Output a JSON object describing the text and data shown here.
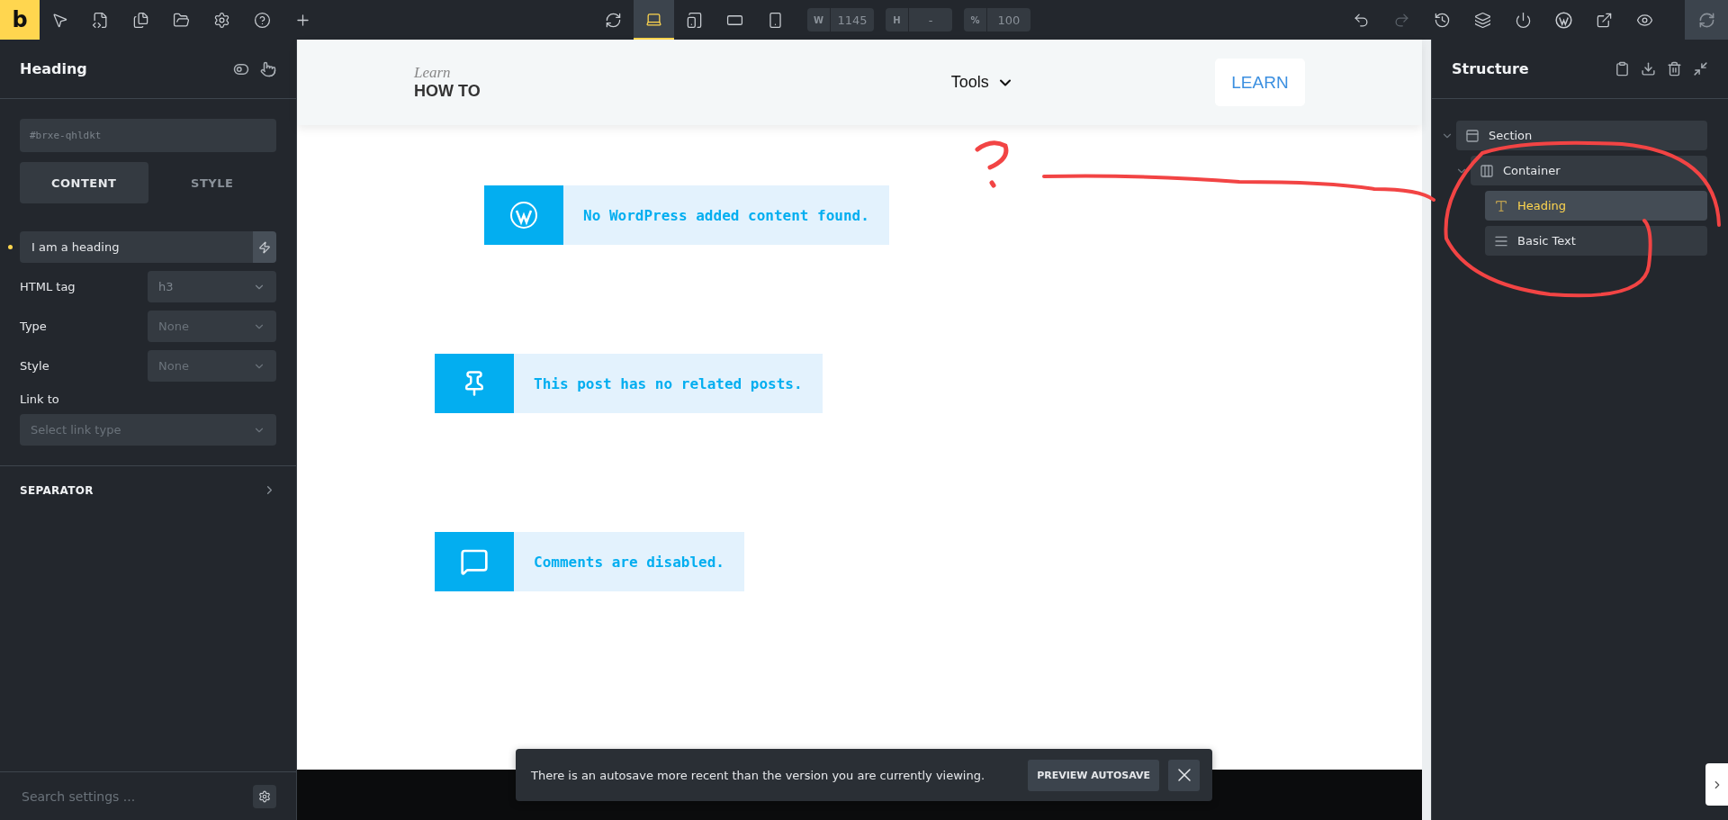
{
  "logo": "b",
  "toolbar": {
    "devices": [
      {
        "kind": "desktop",
        "selected": true
      },
      {
        "kind": "tablet",
        "selected": false
      },
      {
        "kind": "landscape",
        "selected": false
      },
      {
        "kind": "phone",
        "selected": false
      }
    ],
    "fields": [
      {
        "label": "W",
        "value": "1145"
      },
      {
        "label": "H",
        "value": "-"
      },
      {
        "label": "%",
        "value": "100"
      }
    ],
    "redo_disabled": true
  },
  "panel": {
    "title": "Heading",
    "element_id": "#brxe-qhldkt",
    "tabs": [
      {
        "label": "CONTENT",
        "selected": true
      },
      {
        "label": "STYLE",
        "selected": false
      }
    ],
    "text_field": {
      "value": "I am a heading",
      "modified": true
    },
    "controls": [
      {
        "label": "HTML tag",
        "value": "h3",
        "placeholder": false
      },
      {
        "label": "Type",
        "value": "None",
        "placeholder": true
      },
      {
        "label": "Style",
        "value": "None",
        "placeholder": true
      }
    ],
    "link": {
      "label": "Link to",
      "placeholder": "Select link type"
    },
    "group": {
      "label": "SEPARATOR",
      "expanded": false
    },
    "search": {
      "placeholder": "Search settings ..."
    }
  },
  "canvas": {
    "logo_top": "Learn",
    "logo_bottom": "HOW TO",
    "menu": "Tools",
    "cta": "LEARN",
    "notices": [
      {
        "kind": "wordpress",
        "text": "No WordPress added content found."
      },
      {
        "kind": "pin",
        "text": "This post has no related posts."
      },
      {
        "kind": "comments",
        "text": "Comments are disabled."
      }
    ]
  },
  "toast": {
    "message": "There is an autosave more recent than the version you are currently viewing.",
    "action": "PREVIEW AUTOSAVE"
  },
  "structure": {
    "title": "Structure",
    "tree": [
      {
        "label": "Section",
        "kind": "section",
        "expanded": true,
        "selected": false,
        "children": [
          {
            "label": "Container",
            "kind": "container",
            "expanded": true,
            "selected": false,
            "children": [
              {
                "label": "Heading",
                "kind": "heading",
                "selected": true
              },
              {
                "label": "Basic Text",
                "kind": "text",
                "selected": false
              }
            ]
          }
        ]
      }
    ]
  }
}
